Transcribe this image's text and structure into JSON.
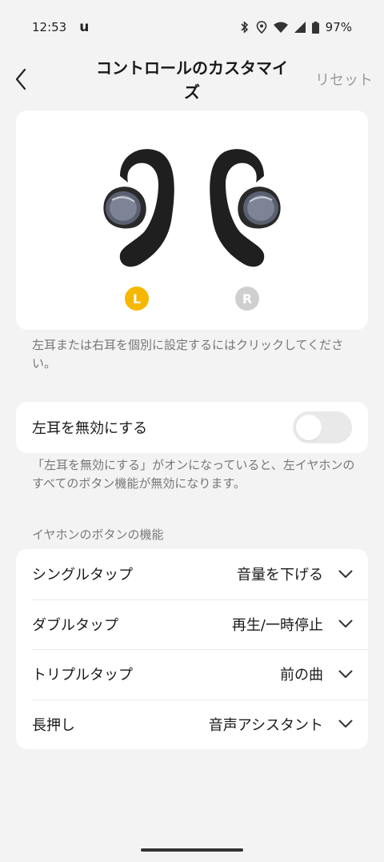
{
  "status_bar": {
    "time": "12:53",
    "app_icon": "u",
    "battery": "97%",
    "icons": [
      "bluetooth-icon",
      "location-icon",
      "wifi-icon",
      "signal-icon",
      "battery-icon"
    ]
  },
  "header": {
    "title": "コントロールのカスタマイズ",
    "reset_label": "リセット",
    "back_icon": "chevron-left-icon"
  },
  "earbuds": {
    "left_label": "L",
    "right_label": "R",
    "selected": "L",
    "accent_color": "#f5b700",
    "inactive_color": "#cfcfcf",
    "hint": "左耳または右耳を個別に設定するにはクリックしてください。"
  },
  "disable": {
    "label": "左耳を無効にする",
    "toggle_on": false,
    "hint": "「左耳を無効にする」がオンになっていると、左イヤホンのすべてのボタン機能が無効になります。"
  },
  "functions": {
    "section_title": "イヤホンのボタンの機能",
    "rows": [
      {
        "label": "シングルタップ",
        "value": "音量を下げる"
      },
      {
        "label": "ダブルタップ",
        "value": "再生/一時停止"
      },
      {
        "label": "トリプルタップ",
        "value": "前の曲"
      },
      {
        "label": "長押し",
        "value": "音声アシスタント"
      }
    ]
  }
}
